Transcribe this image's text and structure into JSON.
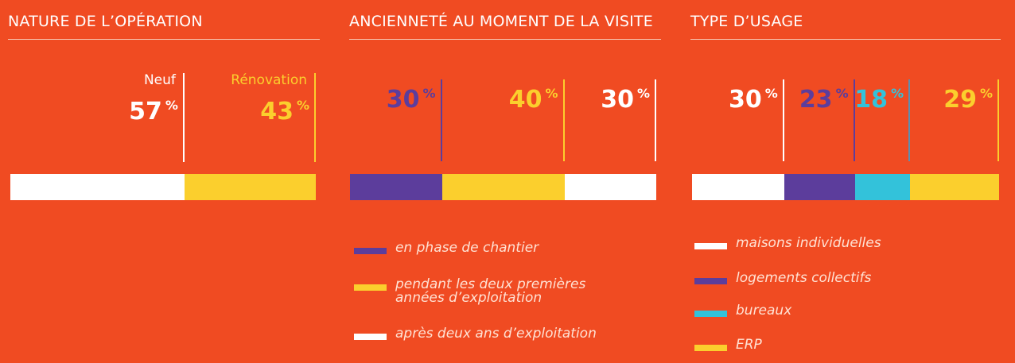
{
  "chart_data": [
    {
      "type": "bar",
      "title": "NATURE DE L’OPÉRATION",
      "categories": [
        "Neuf",
        "Rénovation"
      ],
      "values": [
        57,
        43
      ],
      "value_labels": [
        "57",
        "43"
      ],
      "unit": "%",
      "colors": [
        "#ffffff",
        "#fbcf2d"
      ],
      "stacked": true
    },
    {
      "type": "bar",
      "title": "ANCIENNETÉ AU MOMENT DE LA VISITE",
      "categories": [
        "en phase de chantier",
        "pendant les deux premières années d’exploitation",
        "après deux ans d’exploitation"
      ],
      "values": [
        30,
        40,
        30
      ],
      "value_labels": [
        "30",
        "40",
        "30"
      ],
      "unit": "%",
      "colors": [
        "#5c3d9c",
        "#fbcf2d",
        "#ffffff"
      ],
      "stacked": true,
      "legend": "bottom"
    },
    {
      "type": "bar",
      "title": "TYPE D’USAGE",
      "categories": [
        "maisons individuelles",
        "logements collectifs",
        "bureaux",
        "ERP"
      ],
      "values": [
        30,
        23,
        18,
        29
      ],
      "value_labels": [
        "30",
        "23",
        "18",
        "29"
      ],
      "unit": "%",
      "colors": [
        "#ffffff",
        "#5c3d9c",
        "#33c2da",
        "#fbcf2d"
      ],
      "stacked": true,
      "legend": "bottom"
    }
  ]
}
